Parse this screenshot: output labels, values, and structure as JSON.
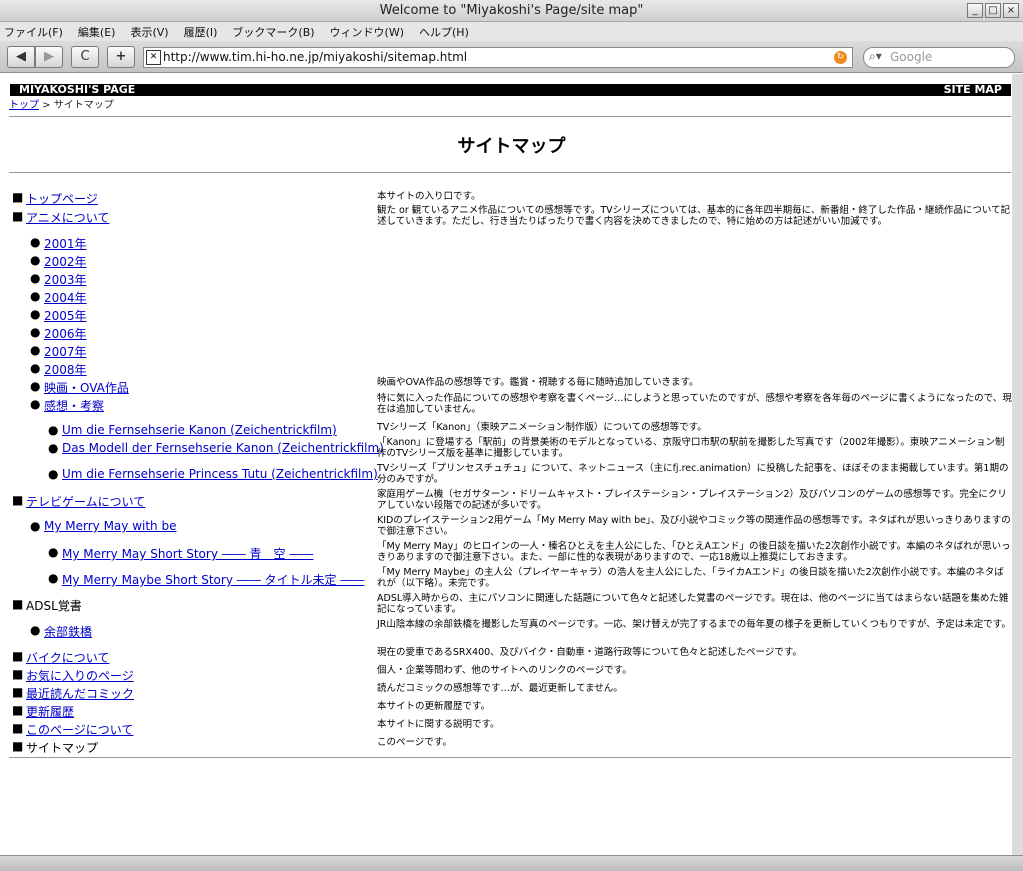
{
  "window": {
    "title": "Welcome to \"Miyakoshi's Page/site map\""
  },
  "menu": [
    "ファイル(F)",
    "編集(E)",
    "表示(V)",
    "履歴(I)",
    "ブックマーク(B)",
    "ウィンドウ(W)",
    "ヘルプ(H)"
  ],
  "toolbar": {
    "back": "◀",
    "forward": "▶",
    "reload": "C",
    "add": "+",
    "url": "http://www.tim.hi-ho.ne.jp/miyakoshi/sitemap.html",
    "search_placeholder": "Google"
  },
  "header": {
    "left": "MIYAKOSHI'S PAGE",
    "right": "SITE MAP"
  },
  "breadcrumb": {
    "home": "トップ",
    "sep": " > ",
    "current": "サイトマップ"
  },
  "page_title": "サイトマップ",
  "entries": [
    {
      "bullet": "■",
      "label": "トップページ",
      "desc": "本サイトの入り口です。"
    },
    {
      "bullet": "■",
      "label": "アニメについて",
      "desc": "観た or 観ているアニメ作品についての感想等です。TVシリーズについては、基本的に各年四半期毎に、新番組・終了した作品・継続作品について記述していきます。ただし、行き当たりばったりで書く内容を決めてきましたので、特に始めの方は記述がいい加減です。"
    },
    {
      "bullet": "●",
      "label": "2001年",
      "desc": ""
    },
    {
      "bullet": "●",
      "label": "2002年",
      "desc": ""
    },
    {
      "bullet": "●",
      "label": "2003年",
      "desc": ""
    },
    {
      "bullet": "●",
      "label": "2004年",
      "desc": ""
    },
    {
      "bullet": "●",
      "label": "2005年",
      "desc": ""
    },
    {
      "bullet": "●",
      "label": "2006年",
      "desc": ""
    },
    {
      "bullet": "●",
      "label": "2007年",
      "desc": ""
    },
    {
      "bullet": "●",
      "label": "2008年",
      "desc": ""
    },
    {
      "bullet": "●",
      "label": "映画・OVA作品",
      "desc": "映画やOVA作品の感想等です。鑑賞・視聴する毎に随時追加していきます。"
    },
    {
      "bullet": "●",
      "label": "感想・考察",
      "desc": "特に気に入った作品についての感想や考察を書くページ…にしようと思っていたのですが、感想や考察を各年毎のページに書くようになったので、現在は追加していません。"
    },
    {
      "bullet": "●",
      "label": "Um die Fernsehserie Kanon (Zeichentrickfilm)",
      "desc": "TVシリーズ「Kanon」（東映アニメーション制作版）についての感想等です。"
    },
    {
      "bullet": "●",
      "label": "Das Modell der Fernsehserie Kanon (Zeichentrickfilm)",
      "desc": "「Kanon」に登場する「駅前」の背景美術のモデルとなっている、京阪守口市駅の駅前を撮影した写真です（2002年撮影）。東映アニメーション制作のTVシリーズ版を基準に撮影しています。"
    },
    {
      "bullet": "●",
      "label": "Um die Fernsehserie Princess Tutu (Zeichentrickfilm)",
      "desc": "TVシリーズ「プリンセスチュチュ」について、ネットニュース（主にfj.rec.animation）に投稿した記事を、ほぼそのまま掲載しています。第1期の分のみですが。"
    },
    {
      "bullet": "■",
      "label": "テレビゲームについて",
      "desc": "家庭用ゲーム機（セガサターン・ドリームキャスト・プレイステーション・プレイステーション2）及びパソコンのゲームの感想等です。完全にクリアしていない段階での記述が多いです。"
    },
    {
      "bullet": "●",
      "label": "My Merry May with be",
      "desc": "KIDのプレイステーション2用ゲーム「My Merry May with be」、及び小説やコミック等の関連作品の感想等です。ネタばれが思いっきりありますので御注意下さい。"
    },
    {
      "bullet": "●",
      "label": "My Merry May Short Story ―― 青　空 ――",
      "desc": "「My Merry May」のヒロインの一人・榛名ひとえを主人公にした、「ひとえAエンド」の後日談を描いた2次創作小説です。本編のネタばれが思いっきりありますので御注意下さい。また、一部に性的な表現がありますので、一応18歳以上推奨にしておきます。"
    },
    {
      "bullet": "●",
      "label": "My Merry Maybe Short Story ―― タイトル未定 ――",
      "desc": "「My Merry Maybe」の主人公（プレイヤーキャラ）の浩人を主人公にした、「ライカAエンド」の後日談を描いた2次創作小説です。本編のネタばれが（以下略）。未完です。"
    },
    {
      "bullet": "■",
      "label": "ADSL覚書",
      "desc": "ADSL導入時からの、主にパソコンに関連した話題について色々と記述した覚書のページです。現在は、他のページに当てはまらない話題を集めた雑記になっています。",
      "plain": true
    },
    {
      "bullet": "●",
      "label": "余部鉄橋",
      "desc": "JR山陰本線の余部鉄橋を撮影した写真のページです。一応、架け替えが完了するまでの毎年夏の様子を更新していくつもりですが、予定は未定です。"
    },
    {
      "bullet": "■",
      "label": "バイクについて",
      "desc": "現在の愛車であるSRX400、及びバイク・自動車・道路行政等について色々と記述したページです。"
    },
    {
      "bullet": "■",
      "label": "お気に入りのページ",
      "desc": "個人・企業等問わず、他のサイトへのリンクのページです。"
    },
    {
      "bullet": "■",
      "label": "最近読んだコミック",
      "desc": "読んだコミックの感想等です…が、最近更新してません。"
    },
    {
      "bullet": "■",
      "label": "更新履歴",
      "desc": "本サイトの更新履歴です。"
    },
    {
      "bullet": "■",
      "label": "このページについて",
      "desc": "本サイトに関する説明です。"
    },
    {
      "bullet": "■",
      "label": "サイトマップ",
      "desc": "このページです。",
      "plain": true
    }
  ]
}
